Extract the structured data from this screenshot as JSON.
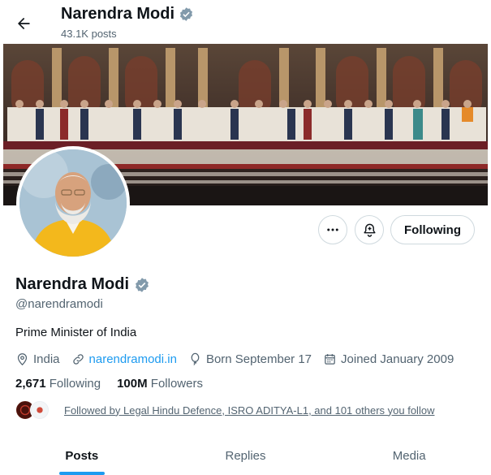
{
  "header": {
    "name": "Narendra Modi",
    "posts_count": "43.1K posts"
  },
  "profile": {
    "name": "Narendra Modi",
    "handle": "@narendramodi",
    "bio": "Prime Minister of India",
    "location": "India",
    "website": "narendramodi.in",
    "born": "Born September 17",
    "joined": "Joined January 2009",
    "following_count": "2,671",
    "following_label": "Following",
    "followers_count": "100M",
    "followers_label": "Followers",
    "followed_by": "Followed by Legal Hindu Defence, ISRO ADITYA-L1, and 101 others you follow"
  },
  "actions": {
    "follow_label": "Following"
  },
  "tabs": [
    {
      "label": "Posts",
      "active": true
    },
    {
      "label": "Replies",
      "active": false
    },
    {
      "label": "Media",
      "active": false
    }
  ],
  "icons": {
    "back": "arrow-left-icon",
    "verified": "verified-badge-icon",
    "more": "more-horizontal-icon",
    "notify": "bell-plus-icon",
    "location": "location-pin-icon",
    "link": "link-icon",
    "born": "balloon-icon",
    "joined": "calendar-icon"
  },
  "colors": {
    "accent": "#1d9bf0",
    "verified": "#829aab",
    "text": "#0f1419",
    "secondary": "#536471"
  }
}
